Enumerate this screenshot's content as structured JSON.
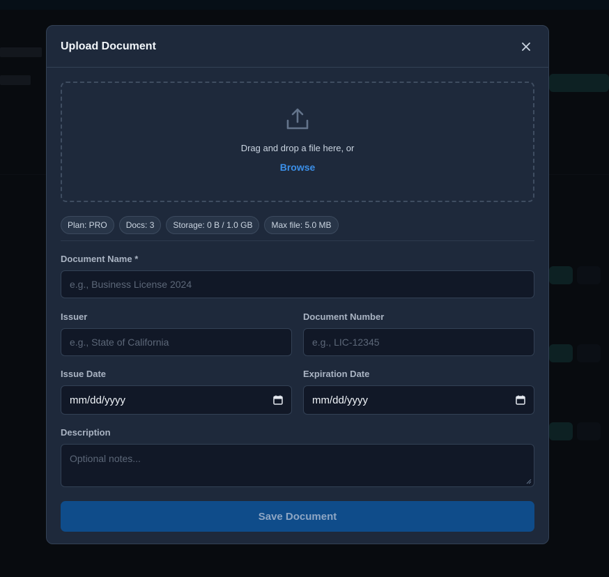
{
  "modal": {
    "title": "Upload Document",
    "close_icon": "close-icon"
  },
  "dropzone": {
    "icon": "upload-icon",
    "instruction": "Drag and drop a file here, or",
    "browse_label": "Browse"
  },
  "badges": [
    "Plan: PRO",
    "Docs: 3",
    "Storage: 0 B / 1.0 GB",
    "Max file: 5.0 MB"
  ],
  "form": {
    "document_name": {
      "label": "Document Name *",
      "placeholder": "e.g., Business License 2024",
      "value": ""
    },
    "issuer": {
      "label": "Issuer",
      "placeholder": "e.g., State of California",
      "value": ""
    },
    "document_number": {
      "label": "Document Number",
      "placeholder": "e.g., LIC-12345",
      "value": ""
    },
    "issue_date": {
      "label": "Issue Date",
      "display": "mm/dd/yyyy"
    },
    "expiration_date": {
      "label": "Expiration Date",
      "display": "mm/dd/yyyy"
    },
    "description": {
      "label": "Description",
      "placeholder": "Optional notes...",
      "value": ""
    },
    "save_label": "Save Document"
  },
  "colors": {
    "accent": "#3b8fe8",
    "primary_button": "#0f4c8a",
    "modal_bg": "#1e293b",
    "input_bg": "#111827"
  }
}
